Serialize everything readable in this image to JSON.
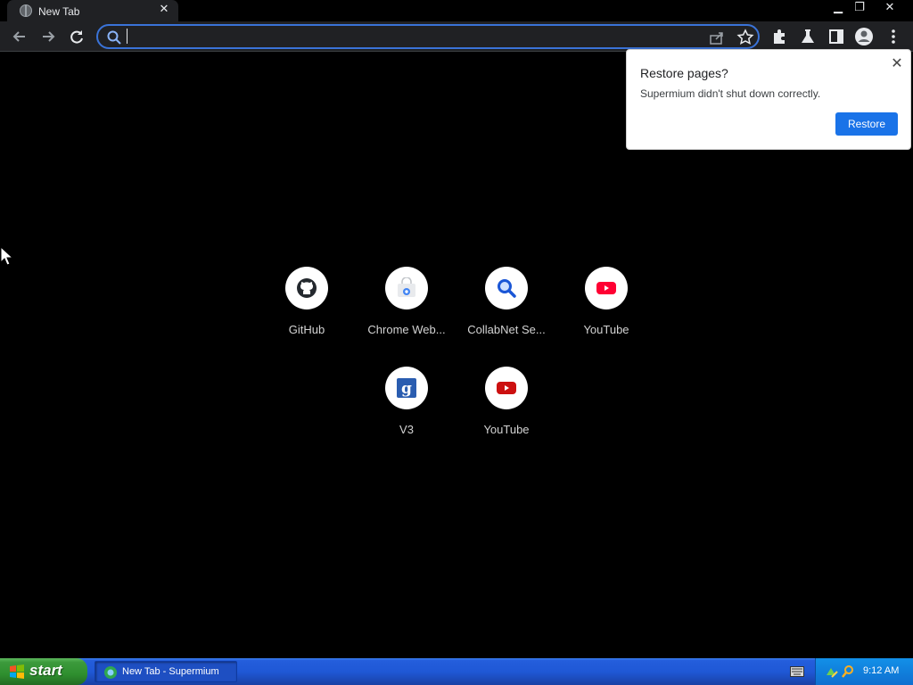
{
  "window": {
    "tab_title": "New Tab",
    "tab_close": "✕",
    "minimize": "▁",
    "restore": "❐",
    "close": "✕"
  },
  "toolbar": {
    "back_icon": "arrow-left-icon",
    "forward_icon": "arrow-right-icon",
    "reload_icon": "reload-icon",
    "omnibox_value": "",
    "omnibox_icons": [
      "search-icon",
      "share-icon",
      "star-icon"
    ],
    "action_icons": [
      "puzzle-icon",
      "flask-icon",
      "side-panel-icon",
      "profile-icon",
      "kebab-menu-icon"
    ],
    "accent": "#3a73d8"
  },
  "restore_bubble": {
    "title": "Restore pages?",
    "message": "Supermium didn't shut down correctly.",
    "button": "Restore",
    "close": "✕",
    "button_color": "#1a73e8"
  },
  "shortcuts": [
    {
      "label": "GitHub",
      "icon": "github-icon"
    },
    {
      "label": "Chrome Web...",
      "icon": "chrome-web-store-icon"
    },
    {
      "label": "CollabNet Se...",
      "icon": "magnifier-icon"
    },
    {
      "label": "YouTube",
      "icon": "youtube-icon"
    },
    {
      "label": "V3",
      "icon": "google-icon"
    },
    {
      "label": "YouTube",
      "icon": "youtube-icon"
    }
  ],
  "taskbar": {
    "start_label": "start",
    "task_label": "New Tab - Supermium",
    "clock": "9:12 AM",
    "start_color": "#2f8f2f",
    "bar_color": "#1f58d6"
  }
}
